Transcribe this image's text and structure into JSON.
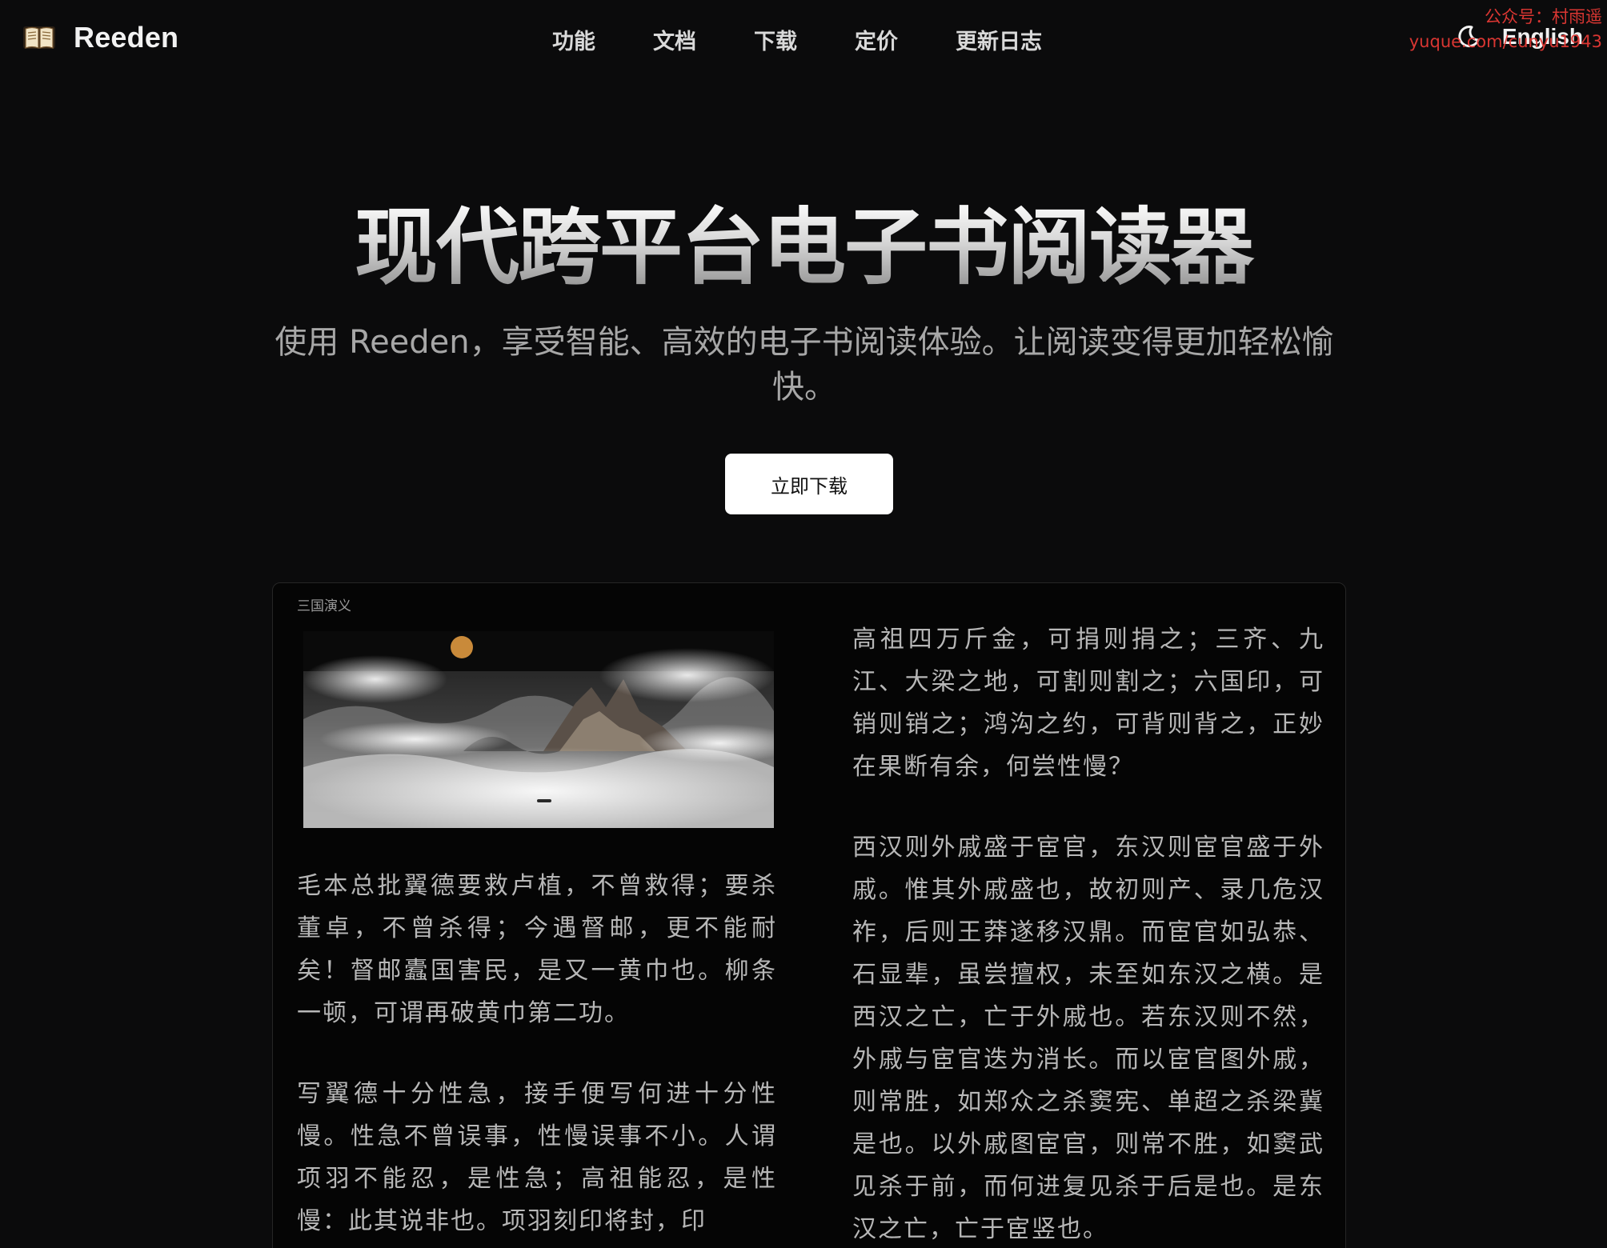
{
  "brand": {
    "name": "Reeden",
    "icon": "open-book-icon"
  },
  "nav": {
    "items": [
      {
        "label": "功能"
      },
      {
        "label": "文档"
      },
      {
        "label": "下载"
      },
      {
        "label": "定价"
      },
      {
        "label": "更新日志"
      }
    ],
    "theme_icon": "moon-icon",
    "language_label": "English"
  },
  "watermark": {
    "line1": "公众号：村雨遥",
    "line2": "yuque.com/cunyu1943"
  },
  "hero": {
    "title": "现代跨平台电子书阅读器",
    "subtitle": "使用 Reeden，享受智能、高效的电子书阅读体验。让阅读变得更加轻松愉快。",
    "cta_label": "立即下载"
  },
  "reader": {
    "book_title": "三国演义",
    "illustration_icon": "ink-mountain-landscape",
    "left_paragraphs": [
      "毛本总批翼德要救卢植，不曾救得；要杀董卓，不曾杀得；今遇督邮，更不能耐矣！督邮蠹国害民，是又一黄巾也。柳条一顿，可谓再破黄巾第二功。",
      "写翼德十分性急，接手便写何进十分性慢。性急不曾误事，性慢误事不小。人谓项羽不能忍，是性急；高祖能忍，是性慢：此其说非也。项羽刻印将封，印"
    ],
    "right_paragraphs": [
      "高祖四万斤金，可捐则捐之；三齐、九江、大梁之地，可割则割之；六国印，可销则销之；鸿沟之约，可背则背之，正妙在果断有余，何尝性慢？",
      "西汉则外戚盛于宦官，东汉则宦官盛于外戚。惟其外戚盛也，故初则产、录几危汉祚，后则王莽遂移汉鼎。而宦官如弘恭、石显辈，虽尝擅权，未至如东汉之横。是西汉之亡，亡于外戚也。若东汉则不然，外戚与宦官迭为消长。而以宦官图外戚，则常胜，如郑众之杀窦宪、单超之杀梁冀是也。以外戚图宦官，则常不胜，如窦武见杀于前，而何进复见杀于后是也。是东汉之亡，亡于宦竖也。"
    ]
  },
  "colors": {
    "background": "#0b0b0c",
    "cta_background": "#ffffff",
    "watermark": "#e53935"
  }
}
